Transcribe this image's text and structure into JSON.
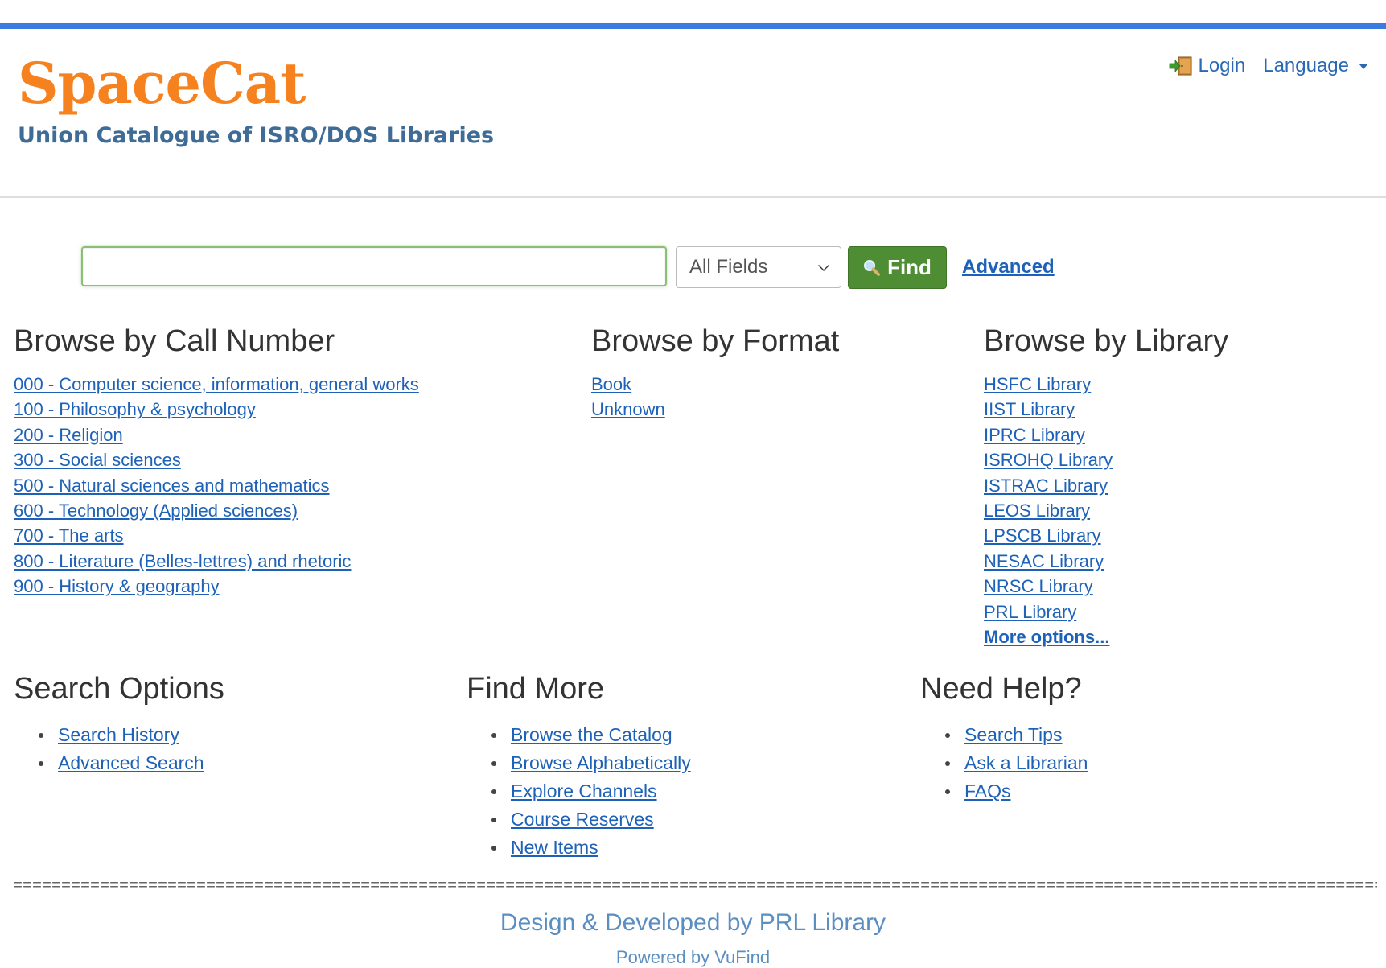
{
  "header": {
    "logo": "SpaceCat",
    "tagline": "Union Catalogue of ISRO/DOS Libraries",
    "login_label": "Login",
    "language_label": "Language"
  },
  "search": {
    "value": "",
    "placeholder": "",
    "field_selected": "All Fields",
    "find_label": "Find",
    "advanced_label": "Advanced"
  },
  "browse_call_number": {
    "heading": "Browse by Call Number",
    "items": [
      "000 - Computer science, information, general works",
      "100 - Philosophy & psychology",
      "200 - Religion",
      "300 - Social sciences",
      "500 - Natural sciences and mathematics",
      "600 - Technology (Applied sciences)",
      "700 - The arts",
      "800 - Literature (Belles-lettres) and rhetoric",
      "900 - History & geography"
    ]
  },
  "browse_format": {
    "heading": "Browse by Format",
    "items": [
      "Book",
      "Unknown"
    ]
  },
  "browse_library": {
    "heading": "Browse by Library",
    "items": [
      "HSFC Library",
      "IIST Library",
      "IPRC Library",
      "ISROHQ Library",
      "ISTRAC Library",
      "LEOS Library",
      "LPSCB Library",
      "NESAC Library",
      "NRSC Library",
      "PRL Library"
    ],
    "more_label": "More options..."
  },
  "search_options": {
    "heading": "Search Options",
    "items": [
      "Search History",
      "Advanced Search"
    ]
  },
  "find_more": {
    "heading": "Find More",
    "items": [
      "Browse the Catalog",
      "Browse Alphabetically",
      "Explore Channels",
      "Course Reserves",
      "New Items"
    ]
  },
  "need_help": {
    "heading": "Need Help?",
    "items": [
      "Search Tips",
      "Ask a Librarian",
      "FAQs"
    ]
  },
  "footer": {
    "separator": "================================================================================================================================================================",
    "credit": "Design & Developed by PRL Library",
    "powered": "Powered by VuFind"
  },
  "colors": {
    "accent_bar": "#3a7be0",
    "logo": "#f5821f",
    "tagline": "#3f6c96",
    "link": "#1d62b8",
    "find_button": "#4e8d33"
  },
  "icons": {
    "login": "login-door-icon",
    "language_caret": "caret-down-icon",
    "select_chevron": "chevron-down-icon",
    "find": "search-icon"
  }
}
